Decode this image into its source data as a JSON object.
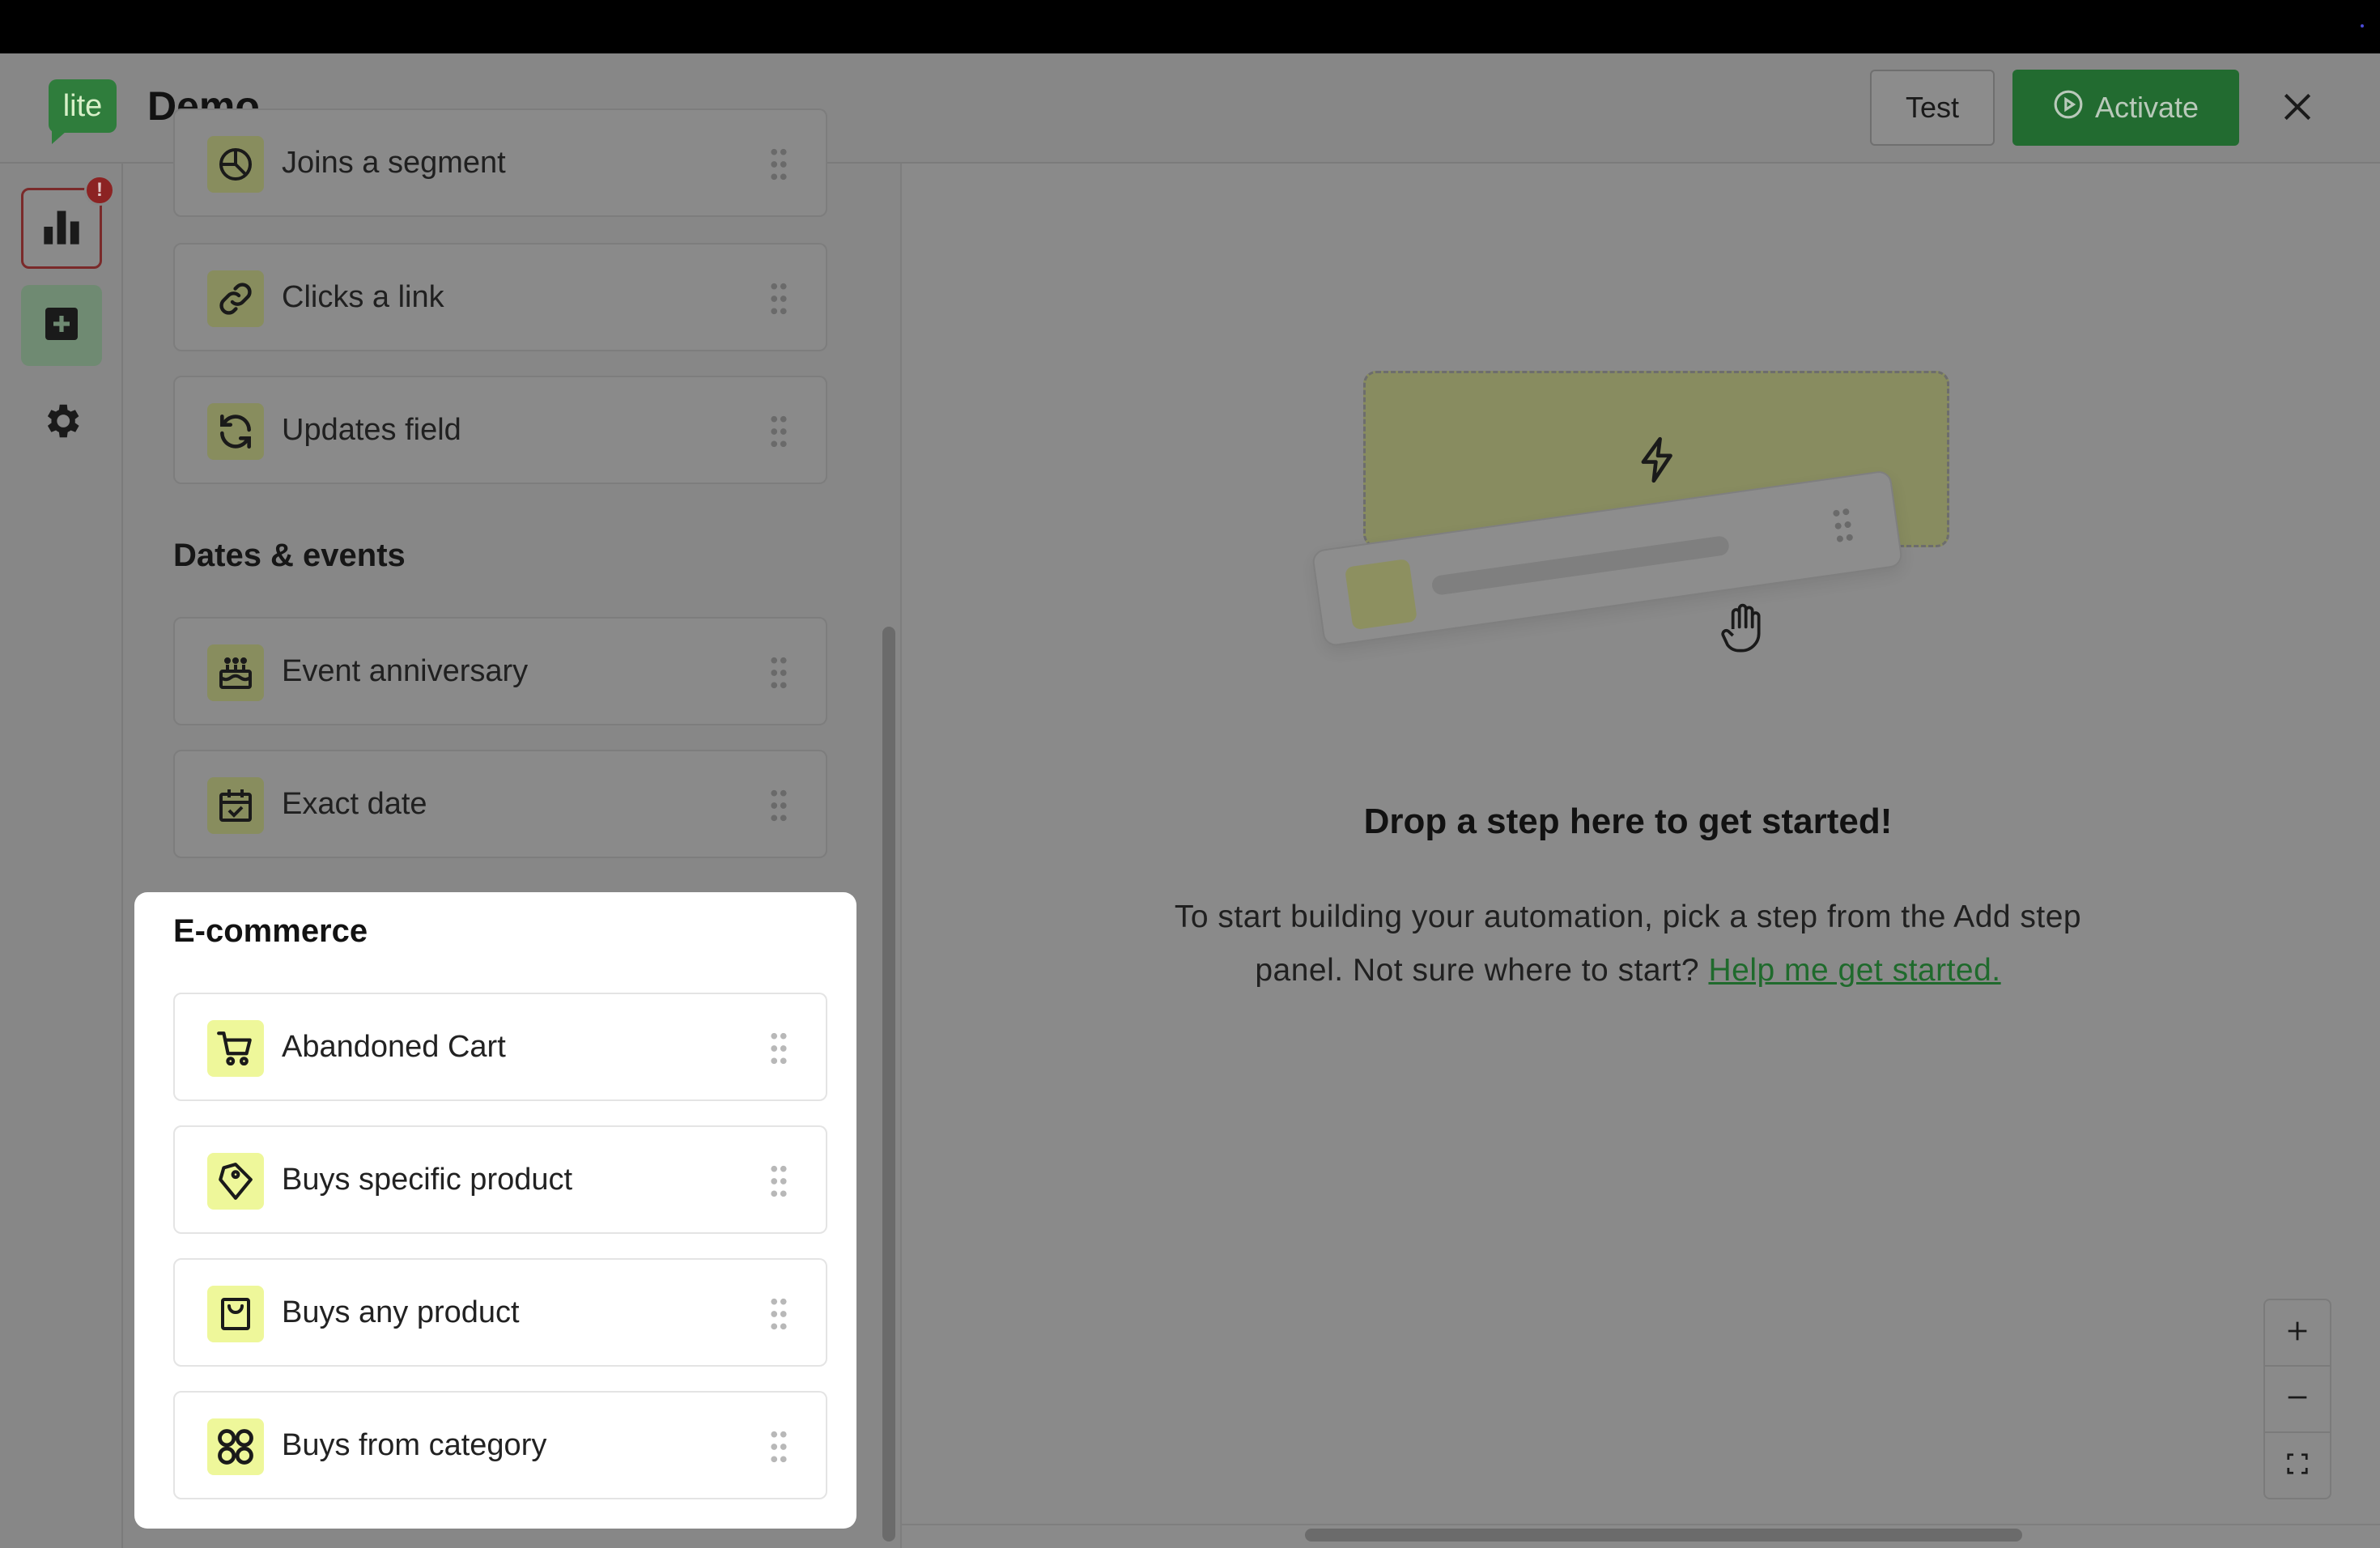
{
  "header": {
    "logo_text": "lite",
    "title": "Demo",
    "test_label": "Test",
    "activate_label": "Activate"
  },
  "rail": {
    "badge": "!"
  },
  "sections": {
    "top_items": [
      {
        "label": "Joins a segment",
        "icon": "segment-icon"
      },
      {
        "label": "Clicks a link",
        "icon": "link-icon"
      },
      {
        "label": "Updates field",
        "icon": "refresh-icon"
      }
    ],
    "dates_title": "Dates & events",
    "dates_items": [
      {
        "label": "Event anniversary",
        "icon": "cake-icon"
      },
      {
        "label": "Exact date",
        "icon": "calendar-check-icon"
      }
    ],
    "ecommerce_title": "E-commerce",
    "ecommerce_items": [
      {
        "label": "Abandoned Cart",
        "icon": "cart-icon"
      },
      {
        "label": "Buys specific product",
        "icon": "tag-icon"
      },
      {
        "label": "Buys any product",
        "icon": "shopping-bag-icon"
      },
      {
        "label": "Buys from category",
        "icon": "category-icon"
      }
    ]
  },
  "canvas": {
    "drop_title": "Drop a step here to get started!",
    "drop_desc_line1": "To start building your automation, pick a step from the Add step",
    "drop_desc_line2": "panel. Not sure where to start?",
    "help_link": "Help me get started."
  },
  "colors": {
    "brand_green": "#2f7d3c",
    "accent_yellow": "#eef79a",
    "badge_red": "#c0392b"
  }
}
